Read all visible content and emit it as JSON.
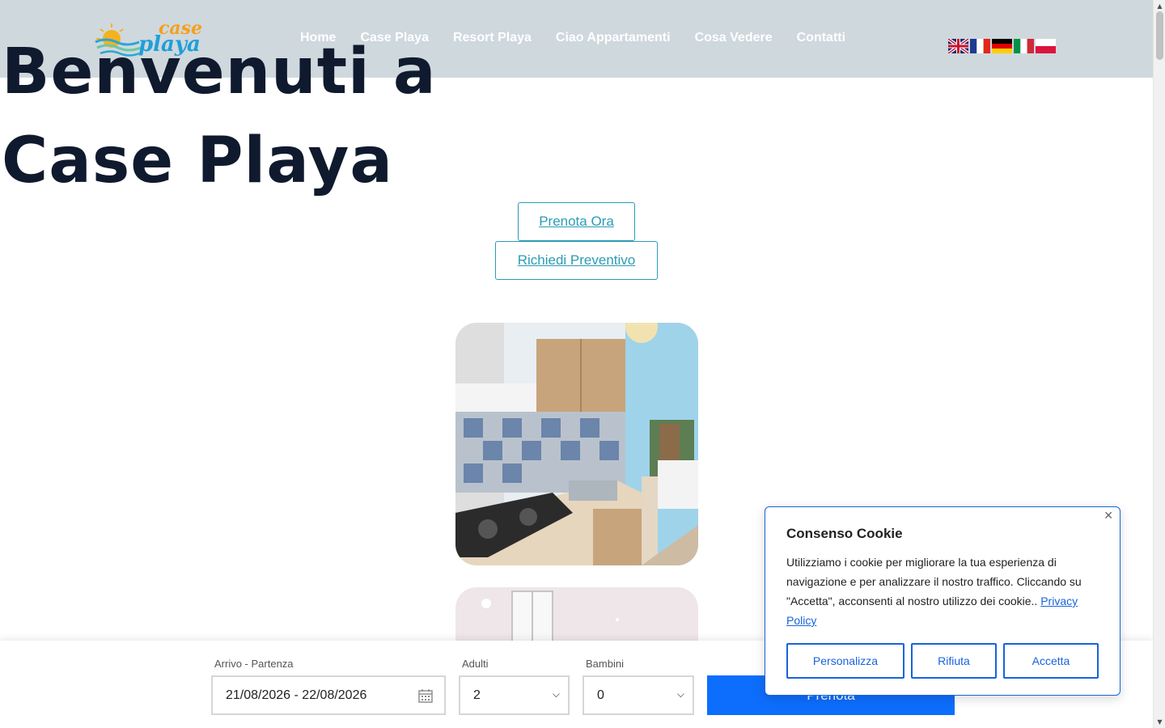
{
  "header": {
    "logo": {
      "word1": "case",
      "word2": "playa"
    },
    "nav": [
      {
        "label": "Home"
      },
      {
        "label": "Case Playa"
      },
      {
        "label": "Resort Playa"
      },
      {
        "label": "Ciao Appartamenti"
      },
      {
        "label": "Cosa Vedere"
      },
      {
        "label": "Contatti"
      }
    ],
    "languages": [
      "english-flag-icon",
      "french-flag-icon",
      "german-flag-icon",
      "italian-flag-icon",
      "polish-flag-icon"
    ]
  },
  "hero": {
    "title_line1": "Benvenuti a",
    "title_line2": "Case Playa",
    "button_book": "Prenota Ora",
    "button_quote": "Richiedi Preventivo"
  },
  "booking": {
    "dates_label": "Arrivo - Partenza",
    "dates_value": "21/08/2026 - 22/08/2026",
    "adults_label": "Adulti",
    "adults_value": "2",
    "children_label": "Bambini",
    "children_value": "0",
    "submit_label": "Prenota"
  },
  "cookie": {
    "title": "Consenso Cookie",
    "text": "Utilizziamo i cookie per migliorare la tua esperienza di navigazione e per analizzare il nostro traffico. Cliccando su \"Accetta\", acconsenti al nostro utilizzo dei cookie..",
    "policy_link": "Privacy Policy",
    "btn_customize": "Personalizza",
    "btn_reject": "Rifiuta",
    "btn_accept": "Accetta"
  },
  "colors": {
    "accent": "#2a9cb4",
    "primary": "#0d6efd",
    "cookie_blue": "#1863dc",
    "heading": "#101a2e"
  }
}
